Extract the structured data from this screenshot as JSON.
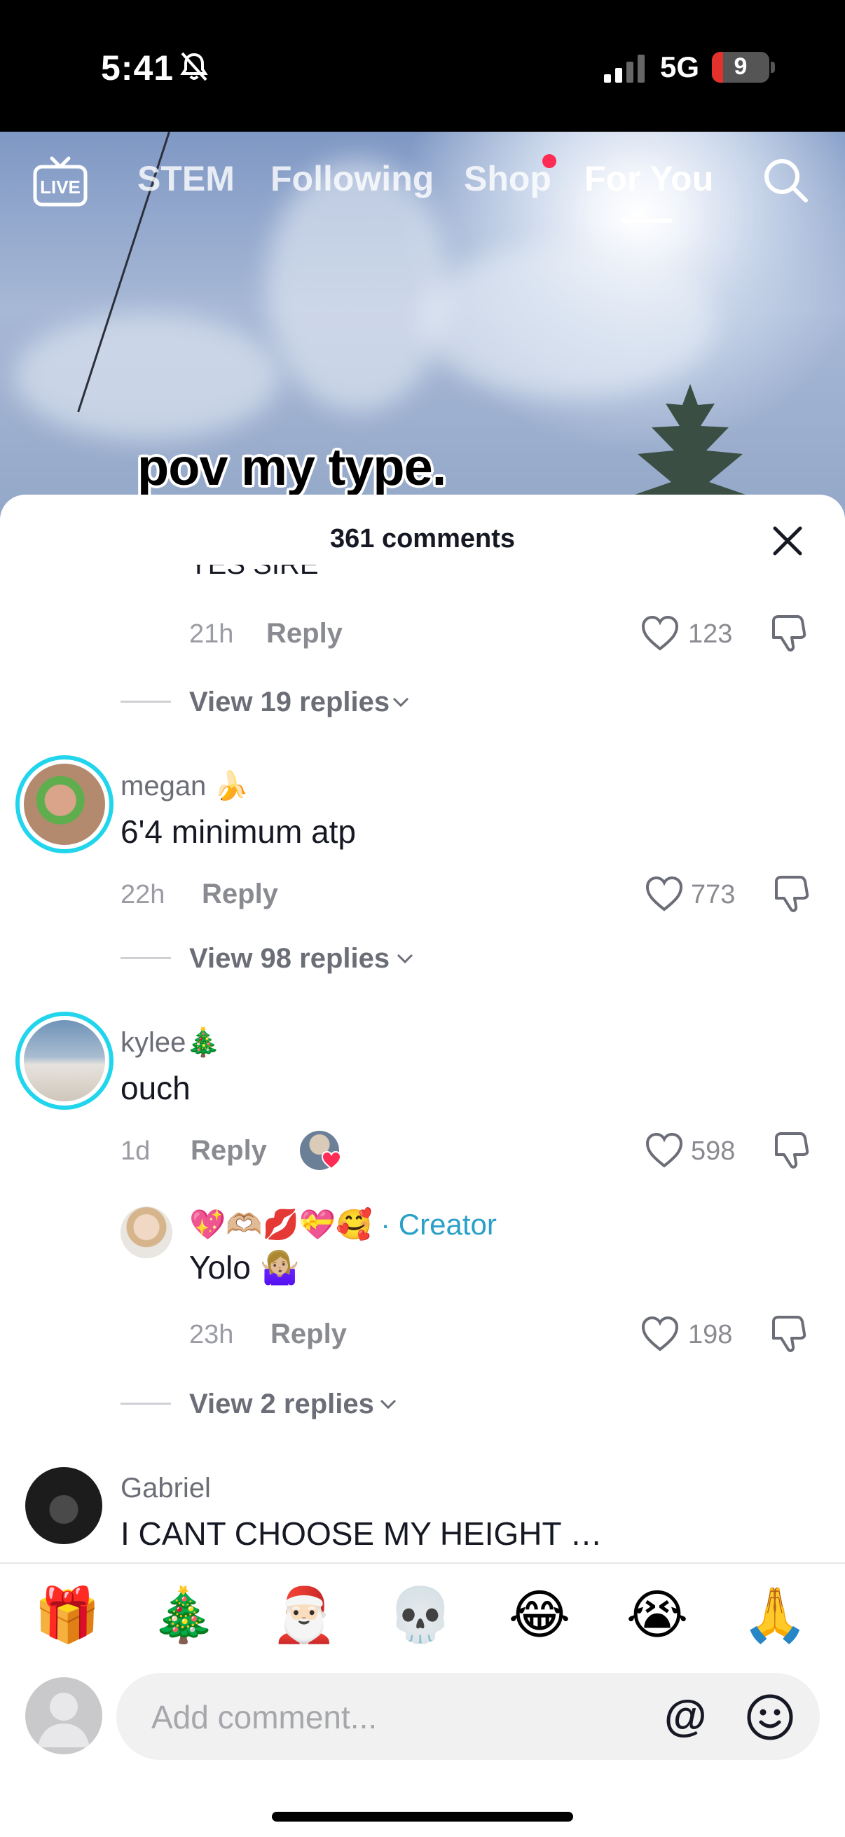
{
  "status_bar": {
    "time": "5:41",
    "network": "5G",
    "battery_level": "9",
    "battery_fraction": 0.09,
    "bell_icon": "bell-slash-icon",
    "signal_icon": "cellular-signal-icon"
  },
  "nav": {
    "live_icon": "live-tv-icon",
    "tabs": [
      {
        "label": "STEM",
        "active": false
      },
      {
        "label": "Following",
        "active": false
      },
      {
        "label": "Shop",
        "active": false,
        "has_dot": true
      },
      {
        "label": "For You",
        "active": true
      }
    ],
    "search_icon": "search-icon"
  },
  "video": {
    "caption": "pov my type."
  },
  "sheet": {
    "title": "361 comments",
    "close_icon": "close-icon",
    "top_comment_tail": {
      "text": "YES SIRE",
      "time": "21h",
      "reply": "Reply",
      "likes": "123",
      "view_replies": "View 19 replies"
    },
    "comments": [
      {
        "username": "megan 🍌",
        "text": "6'4 minimum atp",
        "time": "22h",
        "reply": "Reply",
        "likes": "773",
        "view_replies": "View 98 replies"
      },
      {
        "username": "kylee🎄",
        "text": "ouch",
        "time": "1d",
        "reply": "Reply",
        "likes": "598",
        "creator_liked": true,
        "replies": [
          {
            "username": "💖🫶🏼💋💝🥰",
            "tag": " · Creator",
            "text": "Yolo 🤷🏼‍♀️",
            "time": "23h",
            "reply": "Reply",
            "likes": "198"
          }
        ],
        "view_replies": "View 2 replies"
      },
      {
        "username": "Gabriel",
        "text": "I CANT CHOOSE MY HEIGHT …"
      }
    ]
  },
  "emoji_bar": [
    "🎁",
    "🎄",
    "🎅🏻",
    "💀",
    "😂",
    "😭",
    "🙏"
  ],
  "composer": {
    "placeholder": "Add comment...",
    "mention_symbol": "@",
    "emoji_icon": "smiley-icon"
  },
  "colors": {
    "accent_ring": "#20d5ec",
    "creator_tag": "#2aa0c9",
    "notification_dot": "#fe2c55",
    "battery_low": "#e4312b"
  }
}
